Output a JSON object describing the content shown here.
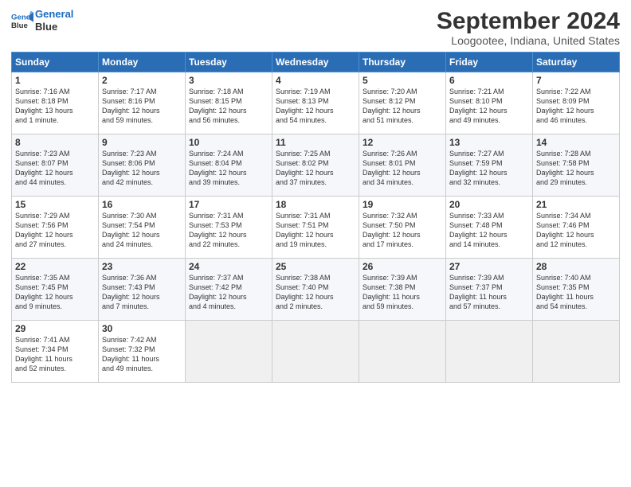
{
  "logo": {
    "line1": "General",
    "line2": "Blue"
  },
  "title": "September 2024",
  "location": "Loogootee, Indiana, United States",
  "days_of_week": [
    "Sunday",
    "Monday",
    "Tuesday",
    "Wednesday",
    "Thursday",
    "Friday",
    "Saturday"
  ],
  "weeks": [
    [
      {
        "day": 1,
        "lines": [
          "Sunrise: 7:16 AM",
          "Sunset: 8:18 PM",
          "Daylight: 13 hours",
          "and 1 minute."
        ]
      },
      {
        "day": 2,
        "lines": [
          "Sunrise: 7:17 AM",
          "Sunset: 8:16 PM",
          "Daylight: 12 hours",
          "and 59 minutes."
        ]
      },
      {
        "day": 3,
        "lines": [
          "Sunrise: 7:18 AM",
          "Sunset: 8:15 PM",
          "Daylight: 12 hours",
          "and 56 minutes."
        ]
      },
      {
        "day": 4,
        "lines": [
          "Sunrise: 7:19 AM",
          "Sunset: 8:13 PM",
          "Daylight: 12 hours",
          "and 54 minutes."
        ]
      },
      {
        "day": 5,
        "lines": [
          "Sunrise: 7:20 AM",
          "Sunset: 8:12 PM",
          "Daylight: 12 hours",
          "and 51 minutes."
        ]
      },
      {
        "day": 6,
        "lines": [
          "Sunrise: 7:21 AM",
          "Sunset: 8:10 PM",
          "Daylight: 12 hours",
          "and 49 minutes."
        ]
      },
      {
        "day": 7,
        "lines": [
          "Sunrise: 7:22 AM",
          "Sunset: 8:09 PM",
          "Daylight: 12 hours",
          "and 46 minutes."
        ]
      }
    ],
    [
      {
        "day": 8,
        "lines": [
          "Sunrise: 7:23 AM",
          "Sunset: 8:07 PM",
          "Daylight: 12 hours",
          "and 44 minutes."
        ]
      },
      {
        "day": 9,
        "lines": [
          "Sunrise: 7:23 AM",
          "Sunset: 8:06 PM",
          "Daylight: 12 hours",
          "and 42 minutes."
        ]
      },
      {
        "day": 10,
        "lines": [
          "Sunrise: 7:24 AM",
          "Sunset: 8:04 PM",
          "Daylight: 12 hours",
          "and 39 minutes."
        ]
      },
      {
        "day": 11,
        "lines": [
          "Sunrise: 7:25 AM",
          "Sunset: 8:02 PM",
          "Daylight: 12 hours",
          "and 37 minutes."
        ]
      },
      {
        "day": 12,
        "lines": [
          "Sunrise: 7:26 AM",
          "Sunset: 8:01 PM",
          "Daylight: 12 hours",
          "and 34 minutes."
        ]
      },
      {
        "day": 13,
        "lines": [
          "Sunrise: 7:27 AM",
          "Sunset: 7:59 PM",
          "Daylight: 12 hours",
          "and 32 minutes."
        ]
      },
      {
        "day": 14,
        "lines": [
          "Sunrise: 7:28 AM",
          "Sunset: 7:58 PM",
          "Daylight: 12 hours",
          "and 29 minutes."
        ]
      }
    ],
    [
      {
        "day": 15,
        "lines": [
          "Sunrise: 7:29 AM",
          "Sunset: 7:56 PM",
          "Daylight: 12 hours",
          "and 27 minutes."
        ]
      },
      {
        "day": 16,
        "lines": [
          "Sunrise: 7:30 AM",
          "Sunset: 7:54 PM",
          "Daylight: 12 hours",
          "and 24 minutes."
        ]
      },
      {
        "day": 17,
        "lines": [
          "Sunrise: 7:31 AM",
          "Sunset: 7:53 PM",
          "Daylight: 12 hours",
          "and 22 minutes."
        ]
      },
      {
        "day": 18,
        "lines": [
          "Sunrise: 7:31 AM",
          "Sunset: 7:51 PM",
          "Daylight: 12 hours",
          "and 19 minutes."
        ]
      },
      {
        "day": 19,
        "lines": [
          "Sunrise: 7:32 AM",
          "Sunset: 7:50 PM",
          "Daylight: 12 hours",
          "and 17 minutes."
        ]
      },
      {
        "day": 20,
        "lines": [
          "Sunrise: 7:33 AM",
          "Sunset: 7:48 PM",
          "Daylight: 12 hours",
          "and 14 minutes."
        ]
      },
      {
        "day": 21,
        "lines": [
          "Sunrise: 7:34 AM",
          "Sunset: 7:46 PM",
          "Daylight: 12 hours",
          "and 12 minutes."
        ]
      }
    ],
    [
      {
        "day": 22,
        "lines": [
          "Sunrise: 7:35 AM",
          "Sunset: 7:45 PM",
          "Daylight: 12 hours",
          "and 9 minutes."
        ]
      },
      {
        "day": 23,
        "lines": [
          "Sunrise: 7:36 AM",
          "Sunset: 7:43 PM",
          "Daylight: 12 hours",
          "and 7 minutes."
        ]
      },
      {
        "day": 24,
        "lines": [
          "Sunrise: 7:37 AM",
          "Sunset: 7:42 PM",
          "Daylight: 12 hours",
          "and 4 minutes."
        ]
      },
      {
        "day": 25,
        "lines": [
          "Sunrise: 7:38 AM",
          "Sunset: 7:40 PM",
          "Daylight: 12 hours",
          "and 2 minutes."
        ]
      },
      {
        "day": 26,
        "lines": [
          "Sunrise: 7:39 AM",
          "Sunset: 7:38 PM",
          "Daylight: 11 hours",
          "and 59 minutes."
        ]
      },
      {
        "day": 27,
        "lines": [
          "Sunrise: 7:39 AM",
          "Sunset: 7:37 PM",
          "Daylight: 11 hours",
          "and 57 minutes."
        ]
      },
      {
        "day": 28,
        "lines": [
          "Sunrise: 7:40 AM",
          "Sunset: 7:35 PM",
          "Daylight: 11 hours",
          "and 54 minutes."
        ]
      }
    ],
    [
      {
        "day": 29,
        "lines": [
          "Sunrise: 7:41 AM",
          "Sunset: 7:34 PM",
          "Daylight: 11 hours",
          "and 52 minutes."
        ]
      },
      {
        "day": 30,
        "lines": [
          "Sunrise: 7:42 AM",
          "Sunset: 7:32 PM",
          "Daylight: 11 hours",
          "and 49 minutes."
        ]
      },
      null,
      null,
      null,
      null,
      null
    ]
  ]
}
